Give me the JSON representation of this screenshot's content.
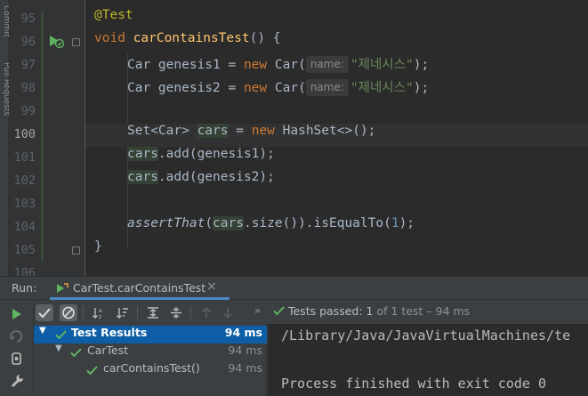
{
  "side_tabs": [
    "Commit",
    "Pull Requests"
  ],
  "editor": {
    "line_numbers": [
      "95",
      "96",
      "97",
      "98",
      "99",
      "100",
      "101",
      "102",
      "103",
      "104",
      "105",
      "106"
    ],
    "hint_name": "name:",
    "lines": {
      "l95_annotation": "@Test",
      "l96_void": "void",
      "l96_method": "carContainsTest",
      "l96_rest": "() {",
      "l97_type": "Car genesis1 = ",
      "l97_new": "new",
      "l97_ctor": " Car(",
      "l97_str": "\"제네시스\"",
      "l97_end": ");",
      "l98_type": "Car genesis2 = ",
      "l98_new": "new",
      "l98_ctor": " Car(",
      "l98_str": "\"제네시스\"",
      "l98_end": ");",
      "l100_set": "Set<Car> ",
      "l100_var": "cars",
      "l100_eq": " = ",
      "l100_new": "new",
      "l100_hs": " HashSet<>();",
      "l101_var": "cars",
      "l101_rest": ".add(genesis1);",
      "l102_var": "cars",
      "l102_rest": ".add(genesis2);",
      "l104_assert": "assertThat",
      "l104_open": "(",
      "l104_var": "cars",
      "l104_mid": ".size()).isEqualTo(",
      "l104_num": "1",
      "l104_end": ");",
      "l105_close": "}"
    }
  },
  "run_panel": {
    "label": "Run:",
    "tab_label": "CarTest.carContainsTest",
    "status_prefix": "Tests passed:",
    "status_count": "1",
    "status_suffix": "of 1 test – 94 ms",
    "tree": [
      {
        "name": "Test Results",
        "time": "94 ms"
      },
      {
        "name": "CarTest",
        "time": "94 ms"
      },
      {
        "name": "carContainsTest()",
        "time": "94 ms"
      }
    ],
    "console_lines": [
      "/Library/Java/JavaVirtualMachines/te",
      "Process finished with exit code 0"
    ]
  },
  "colors": {
    "editor_bg": "#2b2b2b",
    "keyword": "#cc7832",
    "method": "#ffc66d",
    "string": "#6a8759",
    "number": "#6897bb",
    "annotation": "#bbb529",
    "pass_green": "#5fb55f",
    "selection": "#0d5ea6"
  }
}
